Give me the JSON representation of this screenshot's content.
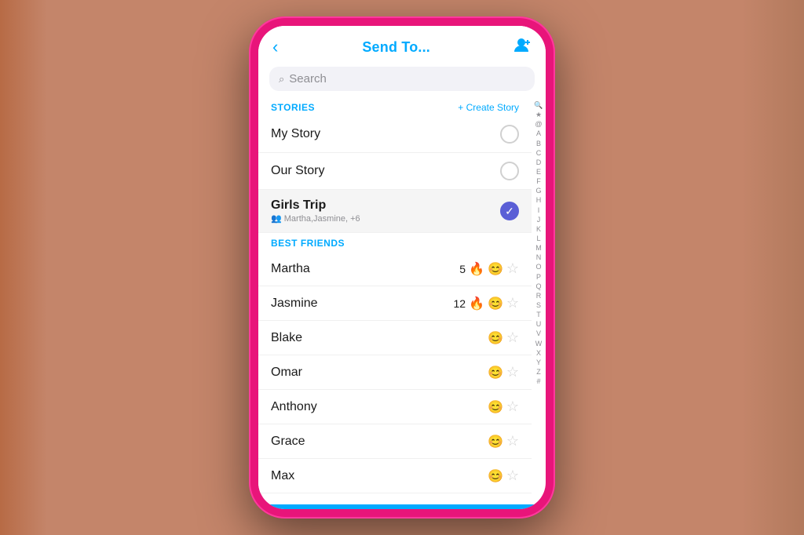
{
  "header": {
    "back_label": "‹",
    "title": "Send To...",
    "add_user_icon": "👤+"
  },
  "search": {
    "placeholder": "Search",
    "icon": "🔍"
  },
  "stories_section": {
    "label": "STORIES",
    "create_btn": "+ Create Story",
    "items": [
      {
        "name": "My Story",
        "bold": false,
        "selected": false,
        "sub": null
      },
      {
        "name": "Our Story",
        "bold": false,
        "selected": false,
        "sub": null
      },
      {
        "name": "Girls Trip",
        "bold": true,
        "selected": true,
        "sub": "👥 Martha,Jasmine, +6"
      }
    ]
  },
  "best_friends_section": {
    "label": "BEST FRIENDS",
    "items": [
      {
        "name": "Martha",
        "streak": "5",
        "fire": true,
        "smile": true,
        "star": true
      },
      {
        "name": "Jasmine",
        "streak": "12",
        "fire": true,
        "smile": true,
        "star": true
      },
      {
        "name": "Blake",
        "streak": "",
        "fire": false,
        "smile": true,
        "star": true
      },
      {
        "name": "Omar",
        "streak": "",
        "fire": false,
        "smile": true,
        "star": true
      },
      {
        "name": "Anthony",
        "streak": "",
        "fire": false,
        "smile": true,
        "star": true
      },
      {
        "name": "Grace",
        "streak": "",
        "fire": false,
        "smile": true,
        "star": true
      },
      {
        "name": "Max",
        "streak": "",
        "fire": false,
        "smile": true,
        "star": true
      }
    ]
  },
  "alpha_sidebar": [
    "🔍",
    "★",
    "@",
    "A",
    "B",
    "C",
    "D",
    "E",
    "F",
    "G",
    "H",
    "I",
    "J",
    "K",
    "L",
    "M",
    "N",
    "O",
    "P",
    "Q",
    "R",
    "S",
    "T",
    "U",
    "V",
    "W",
    "X",
    "Y",
    "Z",
    "#"
  ]
}
